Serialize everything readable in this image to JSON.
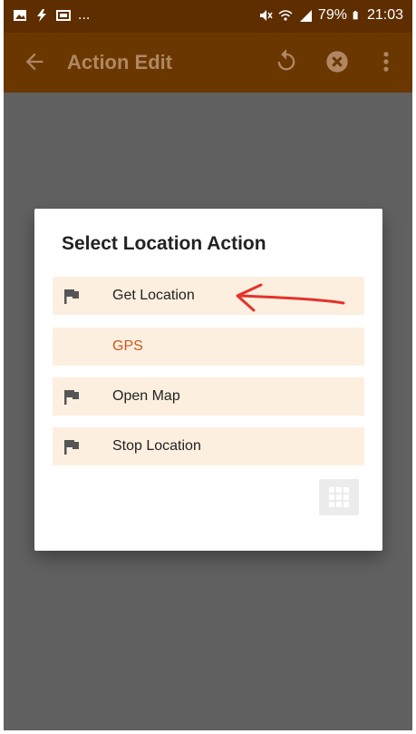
{
  "status_bar": {
    "battery": "79%",
    "time": "21:03",
    "left_icons": [
      "image-icon",
      "flash-icon",
      "mail-icon"
    ],
    "ellipsis": "..."
  },
  "app_bar": {
    "title": "Action Edit",
    "icons": [
      "back-arrow-icon",
      "undo-icon",
      "close-circle-icon",
      "more-vert-icon"
    ]
  },
  "dialog": {
    "title": "Select Location Action",
    "items": [
      {
        "label": "Get Location",
        "icon": "flag-icon"
      },
      {
        "label": "GPS",
        "icon": "",
        "accent": "#c85a1f"
      },
      {
        "label": "Open Map",
        "icon": "flag-icon"
      },
      {
        "label": "Stop Location",
        "icon": "flag-icon"
      }
    ],
    "grid_button_icon": "grid-icon"
  },
  "colors": {
    "appbar": "#6a3700",
    "statusbar": "#5e2e00",
    "overlay": "#616161",
    "item_bg": "#fdefdf",
    "annotation_arrow": "#e5322b"
  }
}
